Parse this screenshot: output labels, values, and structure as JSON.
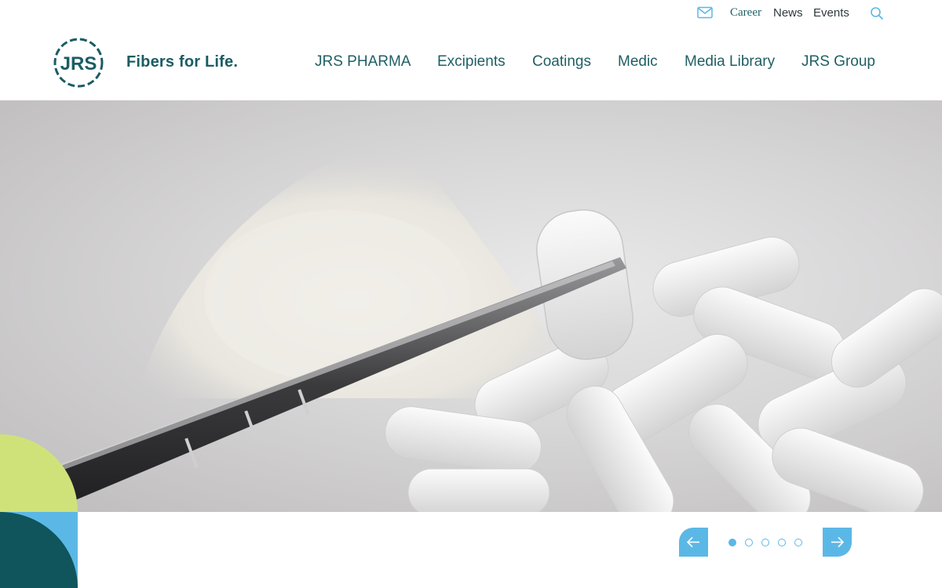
{
  "utility": {
    "mail_icon": "mail-icon",
    "career": "Career",
    "news": "News",
    "events": "Events",
    "search_icon": "search-icon"
  },
  "brand": {
    "logo_text": "JRS",
    "tagline": "Fibers for Life."
  },
  "nav": {
    "items": [
      "JRS PHARMA",
      "Excipients",
      "Coatings",
      "Medic",
      "Media Library",
      "JRS Group"
    ]
  },
  "slider": {
    "slide_count": 5,
    "active_index": 0,
    "prev_icon": "arrow-left-icon",
    "next_icon": "arrow-right-icon"
  },
  "colors": {
    "brand_teal": "#1f5f64",
    "dark_teal": "#0f555b",
    "accent_blue": "#5bb8e6",
    "lime": "#cfe27a"
  }
}
